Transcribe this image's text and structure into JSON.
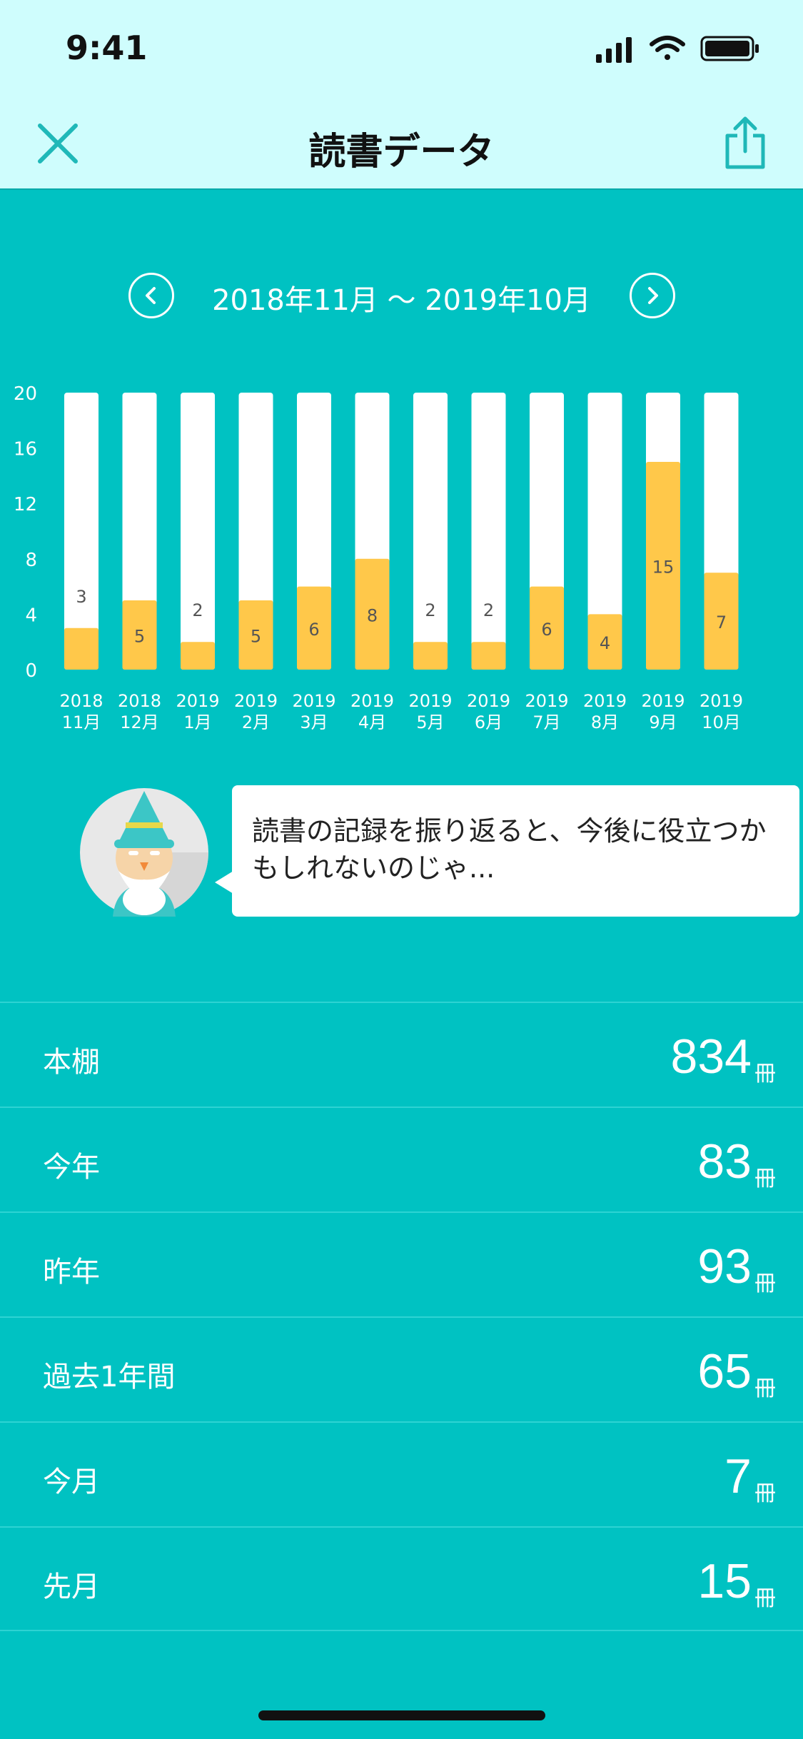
{
  "status": {
    "time": "9:41"
  },
  "nav": {
    "title": "読書データ"
  },
  "period": {
    "label": "2018年11月 〜 2019年10月"
  },
  "chart_data": {
    "type": "bar",
    "ylim": [
      0,
      20
    ],
    "yticks": [
      "0",
      "4",
      "8",
      "12",
      "16",
      "20"
    ],
    "categories": [
      {
        "year": "2018",
        "month": "11月"
      },
      {
        "year": "2018",
        "month": "12月"
      },
      {
        "year": "2019",
        "month": "1月"
      },
      {
        "year": "2019",
        "month": "2月"
      },
      {
        "year": "2019",
        "month": "3月"
      },
      {
        "year": "2019",
        "month": "4月"
      },
      {
        "year": "2019",
        "month": "5月"
      },
      {
        "year": "2019",
        "month": "6月"
      },
      {
        "year": "2019",
        "month": "7月"
      },
      {
        "year": "2019",
        "month": "8月"
      },
      {
        "year": "2019",
        "month": "9月"
      },
      {
        "year": "2019",
        "month": "10月"
      }
    ],
    "values": [
      3,
      5,
      2,
      5,
      6,
      8,
      2,
      2,
      6,
      4,
      15,
      7
    ],
    "colors": {
      "bar": "#FFC84A",
      "track": "#FFFFFF",
      "value_text": "#555555"
    }
  },
  "advice": {
    "text": "読書の記録を振り返ると、今後に役立つかもしれないのじゃ..."
  },
  "stats": [
    {
      "label": "本棚",
      "value": "834",
      "unit": "冊"
    },
    {
      "label": "今年",
      "value": "83",
      "unit": "冊"
    },
    {
      "label": "昨年",
      "value": "93",
      "unit": "冊"
    },
    {
      "label": "過去1年間",
      "value": "65",
      "unit": "冊"
    },
    {
      "label": "今月",
      "value": "7",
      "unit": "冊"
    },
    {
      "label": "先月",
      "value": "15",
      "unit": "冊"
    }
  ],
  "colors": {
    "background": "#00C2C2",
    "header": "#CFFDFD",
    "accent": "#1FB8B8",
    "bar": "#FFC84A"
  }
}
